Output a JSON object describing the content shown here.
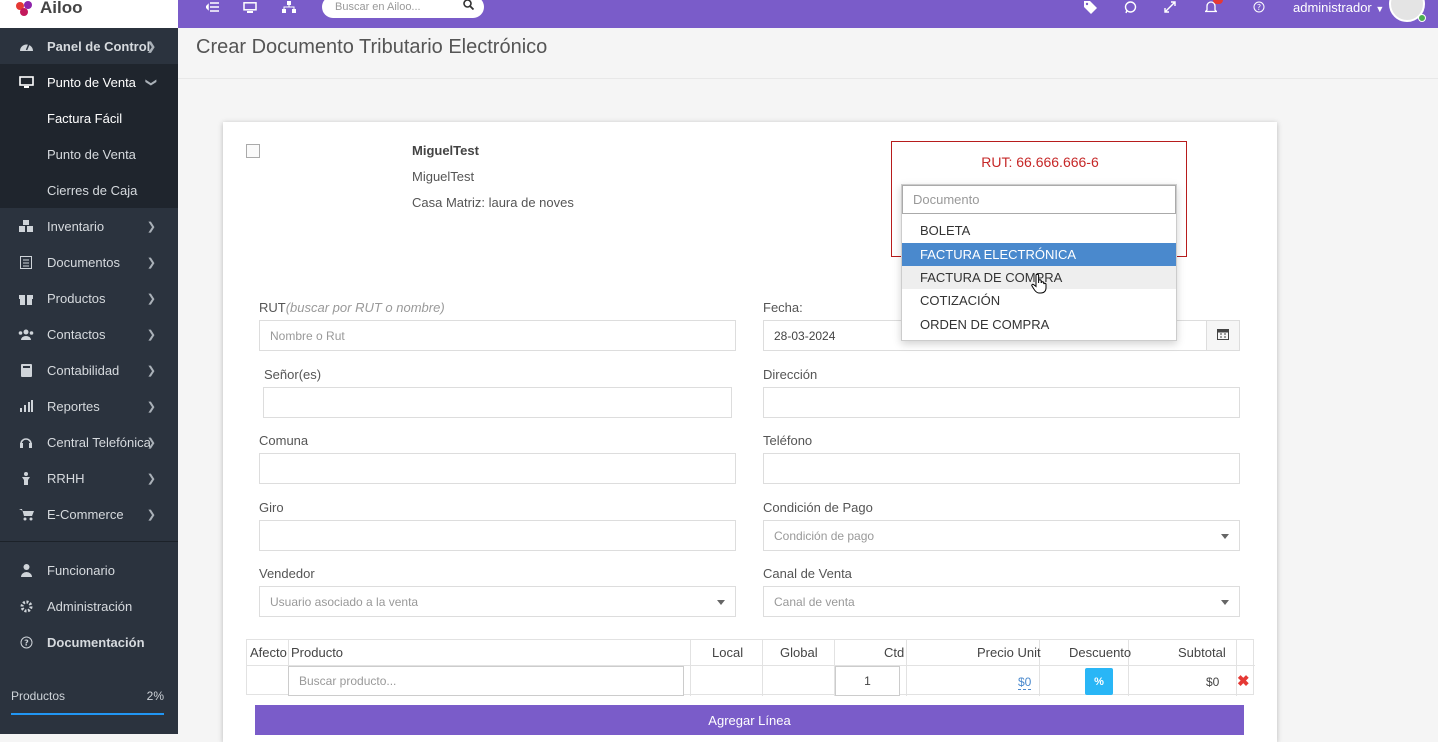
{
  "brand": {
    "name": "Ailoo"
  },
  "sidebar": {
    "items": [
      {
        "label": "Panel de Control",
        "icon": "dashboard-icon"
      },
      {
        "label": "Punto de Venta",
        "icon": "monitor-icon"
      },
      {
        "label": "Inventario",
        "icon": "boxes-icon"
      },
      {
        "label": "Documentos",
        "icon": "list-icon"
      },
      {
        "label": "Productos",
        "icon": "gift-icon"
      },
      {
        "label": "Contactos",
        "icon": "users-icon"
      },
      {
        "label": "Contabilidad",
        "icon": "book-icon"
      },
      {
        "label": "Reportes",
        "icon": "bar-chart-icon"
      },
      {
        "label": "Central Telefónica",
        "icon": "headset-icon"
      },
      {
        "label": "RRHH",
        "icon": "person-icon"
      },
      {
        "label": "E-Commerce",
        "icon": "cart-icon"
      }
    ],
    "subitems": [
      "Factura Fácil",
      "Punto de Venta",
      "Cierres de Caja"
    ],
    "bottom": [
      {
        "label": "Funcionario",
        "icon": "user-icon"
      },
      {
        "label": "Administración",
        "icon": "gear-icon"
      },
      {
        "label": "Documentación",
        "icon": "help-icon"
      }
    ],
    "progress": {
      "label": "Productos",
      "percent_text": "2%",
      "value": 0.02
    }
  },
  "topbar": {
    "search_placeholder": "Buscar en Ailoo...",
    "user": "administrador"
  },
  "page": {
    "title": "Crear Documento Tributario Electrónico"
  },
  "company": {
    "name": "MiguelTest",
    "subname": "MiguelTest",
    "address": "Casa Matriz: laura de noves"
  },
  "rut_box": {
    "rut": "RUT: 66.666.666-6",
    "dropdown_placeholder": "Documento",
    "options": [
      "BOLETA",
      "FACTURA ELECTRÓNICA",
      "FACTURA DE COMPRA",
      "COTIZACIÓN",
      "ORDEN DE COMPRA"
    ],
    "selected_index": 1,
    "hover_index": 2
  },
  "form": {
    "rut_label": "RUT",
    "rut_hint": "(buscar por RUT o nombre)",
    "rut_placeholder": "Nombre o Rut",
    "fecha_label": "Fecha:",
    "fecha_value": "28-03-2024",
    "senor_label": "Señor(es)",
    "direccion_label": "Dirección",
    "comuna_label": "Comuna",
    "telefono_label": "Teléfono",
    "giro_label": "Giro",
    "condicion_label": "Condición de Pago",
    "condicion_placeholder": "Condición de pago",
    "vendedor_label": "Vendedor",
    "vendedor_placeholder": "Usuario asociado a la venta",
    "canal_label": "Canal de Venta",
    "canal_placeholder": "Canal de venta"
  },
  "table": {
    "headers": {
      "afecto": "Afecto",
      "producto": "Producto",
      "local": "Local",
      "global": "Global",
      "ctd": "Ctd",
      "precio": "Precio Unit",
      "descuento": "Descuento",
      "subtotal": "Subtotal"
    },
    "row": {
      "producto_placeholder": "Buscar producto...",
      "ctd": "1",
      "precio": "$0",
      "descuento_btn": "%",
      "subtotal": "$0"
    },
    "add_line": "Agregar Línea"
  },
  "colors": {
    "topbar": "#7a5cc9",
    "sidebar": "#2b333e",
    "selected_option": "#4a89cd",
    "rut_border": "#b71c1c"
  }
}
